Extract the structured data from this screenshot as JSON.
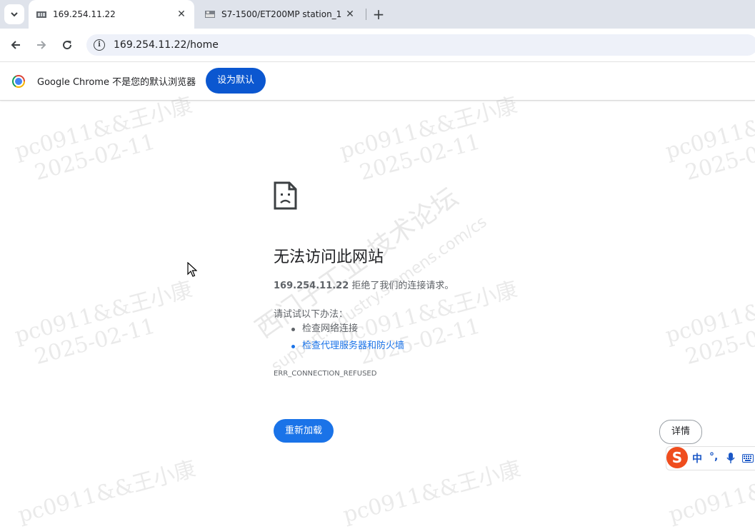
{
  "browser": {
    "tabs": [
      {
        "title": "169.254.11.22",
        "active": true,
        "favicon": "plc-device-icon"
      },
      {
        "title": "S7-1500/ET200MP station_1",
        "active": false,
        "favicon": "s7-1500-icon"
      }
    ],
    "tab_search_icon": "chevron-down-icon",
    "close_glyph": "✕",
    "new_tab_glyph": "+",
    "address": "169.254.11.22/home"
  },
  "infobar": {
    "message": "Google Chrome 不是您的默认浏览器",
    "button": "设为默认"
  },
  "error_page": {
    "title": "无法访问此网站",
    "host": "169.254.11.22",
    "host_message": "拒绝了我们的连接请求。",
    "try_heading": "请试试以下办法：",
    "suggestions": [
      {
        "text": "检查网络连接",
        "link": false
      },
      {
        "text": "检查代理服务器和防火墙",
        "link": true
      }
    ],
    "error_code": "ERR_CONNECTION_REFUSED",
    "reload_button": "重新加载",
    "details_button": "详情"
  },
  "watermark": {
    "line1": "pc0911&&王小康",
    "line2": "2025-02-11",
    "forum": "西门子工业 技术论坛",
    "forum_url": "support.industry.siemens.com/cs"
  },
  "ime": {
    "logo": "S",
    "mode": "中",
    "punct": "°,",
    "mic": "🎤",
    "keyboard": "⌨"
  },
  "colors": {
    "accent": "#1a73e8",
    "infobar_button": "#0b57d0",
    "tabstrip": "#dfe3eb",
    "omnibox": "#eef1f9"
  }
}
